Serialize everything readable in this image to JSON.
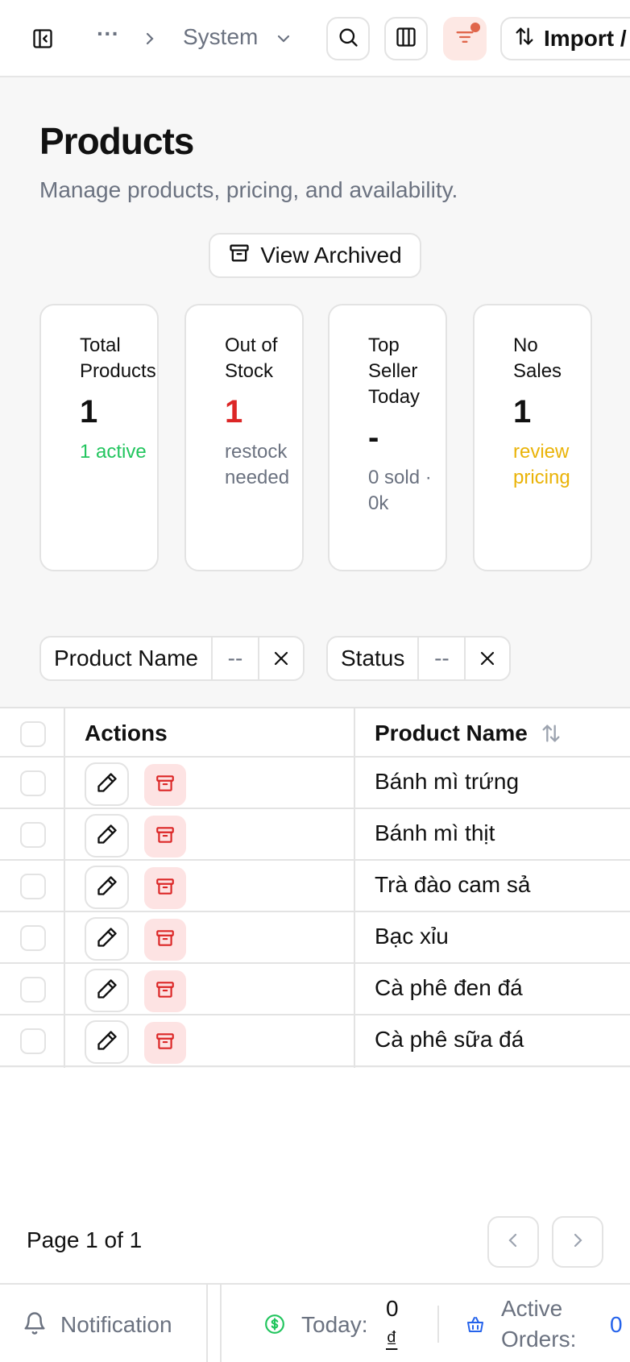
{
  "topbar": {
    "breadcrumb_more": "···",
    "breadcrumb_current": "System",
    "import_label": "Import /"
  },
  "header": {
    "title": "Products",
    "subtitle": "Manage products, pricing, and availability.",
    "view_archived": "View Archived"
  },
  "stats": [
    {
      "label": "Total Products",
      "value": "1",
      "note": "1 active",
      "value_color": "#111111",
      "note_color": "#22c55e"
    },
    {
      "label": "Out of Stock",
      "value": "1",
      "note": "restock needed",
      "value_color": "#dc2626",
      "note_color": "#6b7280"
    },
    {
      "label": "Top Seller Today",
      "value": "-",
      "note": "0 sold · 0k",
      "value_color": "#111111",
      "note_color": "#6b7280"
    },
    {
      "label": "No Sales",
      "value": "1",
      "note": "review pricing",
      "value_color": "#111111",
      "note_color": "#eab308"
    }
  ],
  "filters": [
    {
      "label": "Product Name",
      "op": "--"
    },
    {
      "label": "Status",
      "op": "--"
    }
  ],
  "table": {
    "headers": {
      "actions": "Actions",
      "name": "Product Name"
    },
    "rows": [
      {
        "name": "Bánh mì trứng"
      },
      {
        "name": "Bánh mì thịt"
      },
      {
        "name": "Trà đào cam sả"
      },
      {
        "name": "Bạc xỉu"
      },
      {
        "name": "Cà phê đen đá"
      },
      {
        "name": "Cà phê sữa đá"
      }
    ]
  },
  "pagination": {
    "text": "Page 1 of 1"
  },
  "bottombar": {
    "notification": "Notification",
    "today_label": "Today:",
    "today_value": "0",
    "today_currency": "₫",
    "active_orders_line1": "Active",
    "active_orders_line2": "Orders:",
    "active_orders_value": "0"
  },
  "colors": {
    "accent_red": "#dc2626",
    "filter_badge": "#e0654a",
    "green": "#22c55e",
    "yellow": "#eab308",
    "blue": "#2563eb"
  }
}
